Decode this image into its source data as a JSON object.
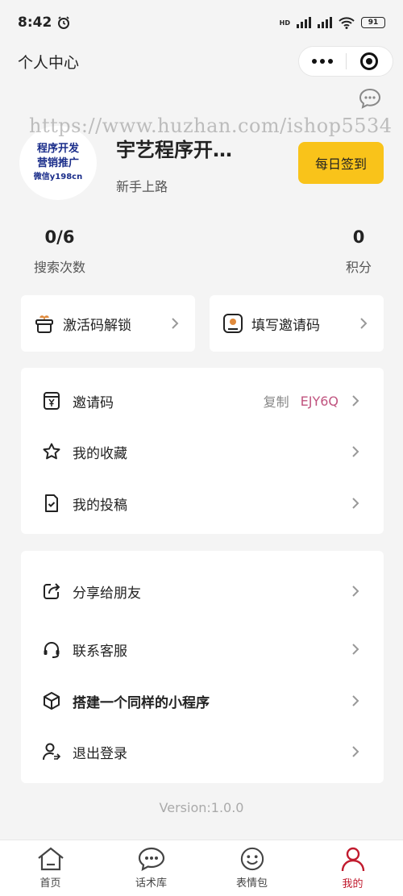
{
  "status": {
    "time": "8:42",
    "battery": "91",
    "network_tag": "HD"
  },
  "navbar": {
    "title": "个人中心"
  },
  "watermark": "https://www.huzhan.com/ishop5534",
  "profile": {
    "avatar_lines": [
      "程序开发",
      "营销推广",
      "微信y198cn"
    ],
    "name": "宇艺程序开…",
    "level": "新手上路",
    "signin_label": "每日签到"
  },
  "stats": {
    "search": {
      "value": "0/6",
      "label": "搜索次数"
    },
    "points": {
      "value": "0",
      "label": "积分"
    }
  },
  "quick": {
    "activate": "激活码解锁",
    "invite": "填写邀请码"
  },
  "menu1": [
    {
      "label": "邀请码",
      "copy": "复制",
      "code": "EJY6Q",
      "icon": "yen-card-icon"
    },
    {
      "label": "我的收藏",
      "icon": "star-icon"
    },
    {
      "label": "我的投稿",
      "icon": "doc-check-icon"
    }
  ],
  "menu2": [
    {
      "label": "分享给朋友",
      "icon": "share-icon"
    },
    {
      "label": "联系客服",
      "icon": "headset-icon"
    },
    {
      "label": "搭建一个同样的小程序",
      "icon": "cube-icon"
    },
    {
      "label": "退出登录",
      "icon": "user-logout-icon"
    }
  ],
  "version": "Version:1.0.0",
  "tabs": [
    {
      "label": "首页",
      "icon": "home-icon"
    },
    {
      "label": "话术库",
      "icon": "chat-icon"
    },
    {
      "label": "表情包",
      "icon": "smile-icon"
    },
    {
      "label": "我的",
      "icon": "user-icon",
      "active": true
    }
  ],
  "colors": {
    "accent": "#f9c31a",
    "active_tab": "#c11b2e",
    "invite_code": "#c0547f"
  }
}
